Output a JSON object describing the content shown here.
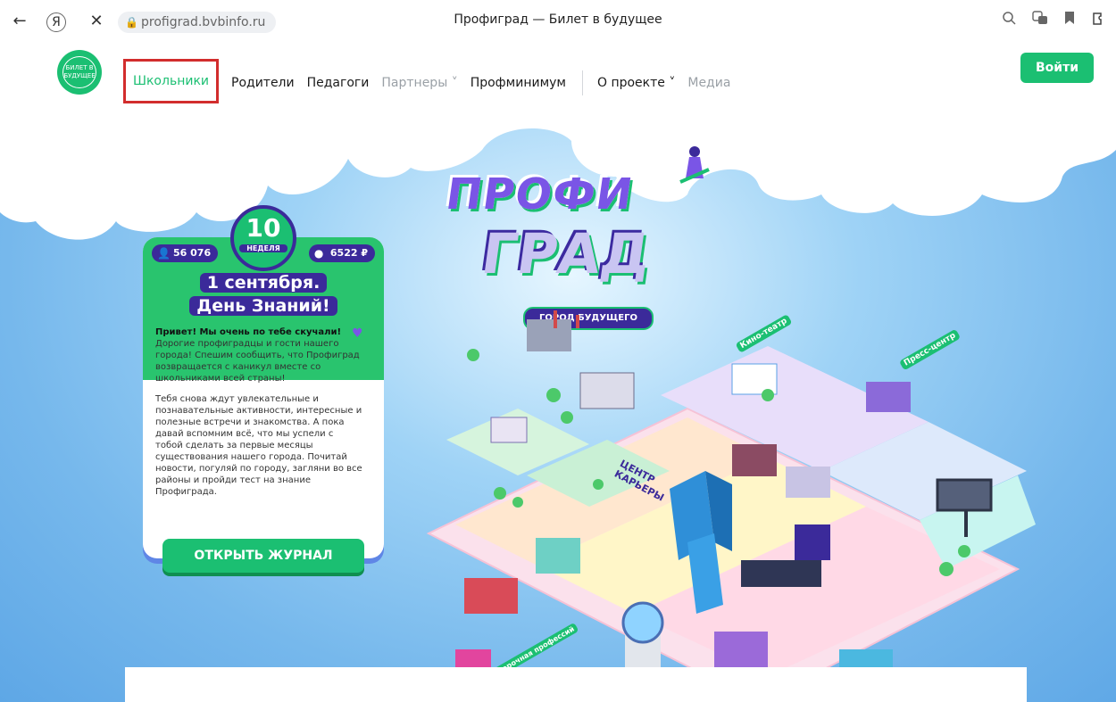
{
  "browser": {
    "url": "profigrad.bvbinfo.ru",
    "title": "Профиград — Билет в будущее",
    "back_glyph": "←",
    "yandex_glyph": "Я",
    "close_glyph": "✕",
    "lock_glyph": "🔒"
  },
  "header": {
    "logo_text": "БИЛЕТ В БУДУЩЕЕ",
    "nav": [
      {
        "label": "Школьники"
      },
      {
        "label": "Родители"
      },
      {
        "label": "Педагоги"
      },
      {
        "label": "Партнеры ˅"
      },
      {
        "label": "Профминимум"
      },
      {
        "label": "О проекте ˅"
      },
      {
        "label": "Медиа"
      }
    ],
    "login_label": "Войти"
  },
  "hero": {
    "line1": "ПРОФИ",
    "line2": "ГРАД",
    "subtitle": "ГОРОД БУДУЩЕГО"
  },
  "card": {
    "participants": "56 076",
    "coins": "6522 ₽",
    "week_number": "10",
    "week_label": "НЕДЕЛЯ",
    "title_line1": "1 сентября.",
    "title_line2": "День Знаний!",
    "lead": "Привет! Мы очень по тебе скучали!",
    "paragraph1": "Дорогие профиградцы и гости нашего города! Спешим сообщить, что Профиград возвращается с каникул вместе со школьниками всей страны!",
    "paragraph2": "Тебя снова ждут увлекательные и познавательные активности, интересные и полезные встречи и знакомства. А пока давай вспомним всё, что мы успели с тобой сделать за первые месяцы существования нашего города. Почитай новости, погуляй по городу, загляни во все районы и пройди тест на знание Профиграда.",
    "button": "ОТКРЫТЬ ЖУРНАЛ"
  },
  "city": {
    "labels": {
      "career_center": "ЦЕНТР КАРЬЕРЫ",
      "cinema": "Кино-театр",
      "press": "Пресс-центр",
      "professions": "Примерочная профессий"
    }
  },
  "colors": {
    "brand_green": "#1bbf72",
    "brand_purple": "#3b2a9a",
    "highlight_red": "#d22d2d"
  }
}
